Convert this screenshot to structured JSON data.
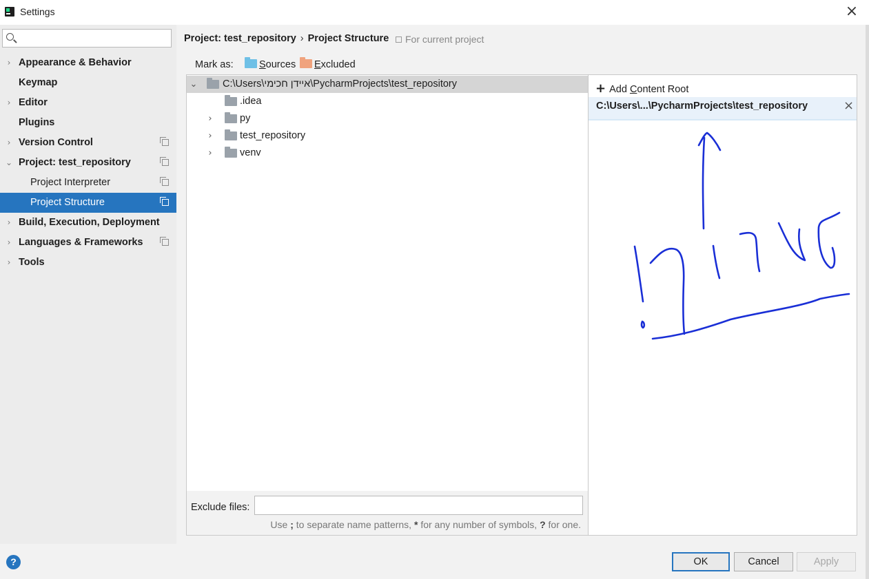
{
  "window": {
    "title": "Settings"
  },
  "sidebar": {
    "search_placeholder": "",
    "items": [
      {
        "label": "Appearance & Behavior",
        "chevron": "›"
      },
      {
        "label": "Keymap"
      },
      {
        "label": "Editor",
        "chevron": "›"
      },
      {
        "label": "Plugins"
      },
      {
        "label": "Version Control",
        "chevron": "›"
      },
      {
        "label": "Project: test_repository",
        "chevron": "⌄"
      },
      {
        "label": "Project Interpreter"
      },
      {
        "label": "Project Structure"
      },
      {
        "label": "Build, Execution, Deployment",
        "chevron": "›"
      },
      {
        "label": "Languages & Frameworks",
        "chevron": "›"
      },
      {
        "label": "Tools",
        "chevron": "›"
      }
    ],
    "selected_color": "#2675bf"
  },
  "header": {
    "project": "Project: test_repository",
    "separator": "›",
    "page": "Project Structure",
    "scope": "For current project"
  },
  "mark_as": {
    "label": "Mark as:",
    "sources_first": "S",
    "sources_rest": "ources",
    "excluded_first": "E",
    "excluded_rest": "xcluded",
    "sources_color": "#6fc0e6",
    "excluded_color": "#f0a37e"
  },
  "tree": {
    "root_path": "C:\\Users\\איידן חכימי\\PycharmProjects\\test_repository",
    "root_chevron": "⌄",
    "children": [
      {
        "name": ".idea",
        "chevron": ""
      },
      {
        "name": "py",
        "chevron": "›"
      },
      {
        "name": "test_repository",
        "chevron": "›"
      },
      {
        "name": "venv",
        "chevron": "›"
      }
    ]
  },
  "exclude": {
    "label": "Exclude files:",
    "value": "",
    "hint_prefix": "Use",
    "hint_sep": ";",
    "hint_mid": "to separate name patterns,",
    "hint_star": "*",
    "hint_mid2": "for any number of symbols,",
    "hint_q": "?",
    "hint_end": "for one."
  },
  "content_root": {
    "add_label_pre": "Add ",
    "add_label_ul": "C",
    "add_label_post": "ontent Root",
    "path": "C:\\Users\\...\\PycharmProjects\\test_repository",
    "remove_icon": "×"
  },
  "footer": {
    "help": "?",
    "ok": "OK",
    "cancel": "Cancel",
    "apply": "Apply"
  },
  "annotation": {
    "color": "#1a2fd6"
  },
  "icons": [
    "app-icon",
    "search-icon",
    "copy-icon",
    "folder-icon",
    "plus-icon",
    "close-icon",
    "help-icon"
  ]
}
